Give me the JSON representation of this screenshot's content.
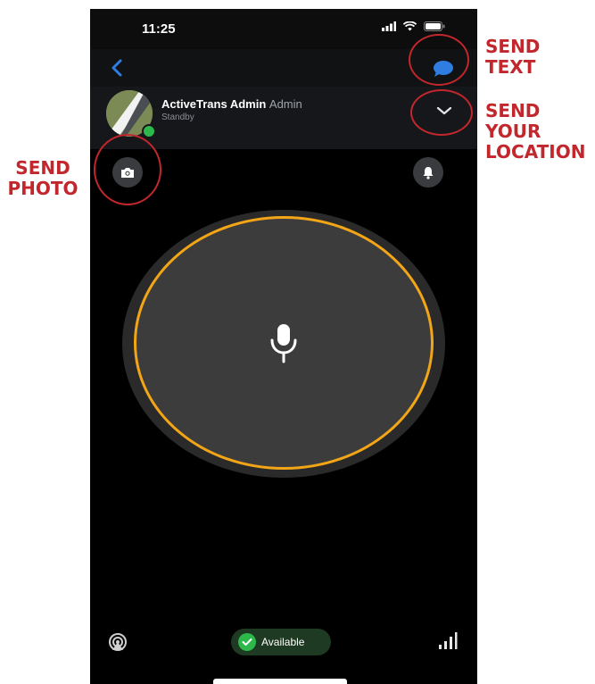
{
  "status_bar": {
    "time": "11:25",
    "icons": [
      "signal-icon",
      "wifi-icon",
      "battery-icon"
    ]
  },
  "nav": {
    "back_icon": "chevron-left-icon",
    "message_icon": "chat-bubble-icon"
  },
  "contact": {
    "name": "ActiveTrans Admin",
    "role": "Admin",
    "status": "Standby",
    "presence_color": "#2db84b"
  },
  "actions": {
    "camera_icon": "camera-icon",
    "alert_icon": "bell-icon",
    "ptt_icon": "microphone-icon"
  },
  "bottom_bar": {
    "left_icon": "broadcast-icon",
    "availability": "Available",
    "right_icon": "signal-bars-icon"
  },
  "annotations": {
    "send_text": [
      "SEND",
      "TEXT"
    ],
    "send_location": [
      "SEND",
      "YOUR",
      "LOCATION"
    ],
    "send_photo": [
      "SEND",
      "PHOTO"
    ]
  },
  "colors": {
    "accent_ring": "#f2a516",
    "annotation": "#c1272d",
    "link_blue": "#2f7de1"
  }
}
